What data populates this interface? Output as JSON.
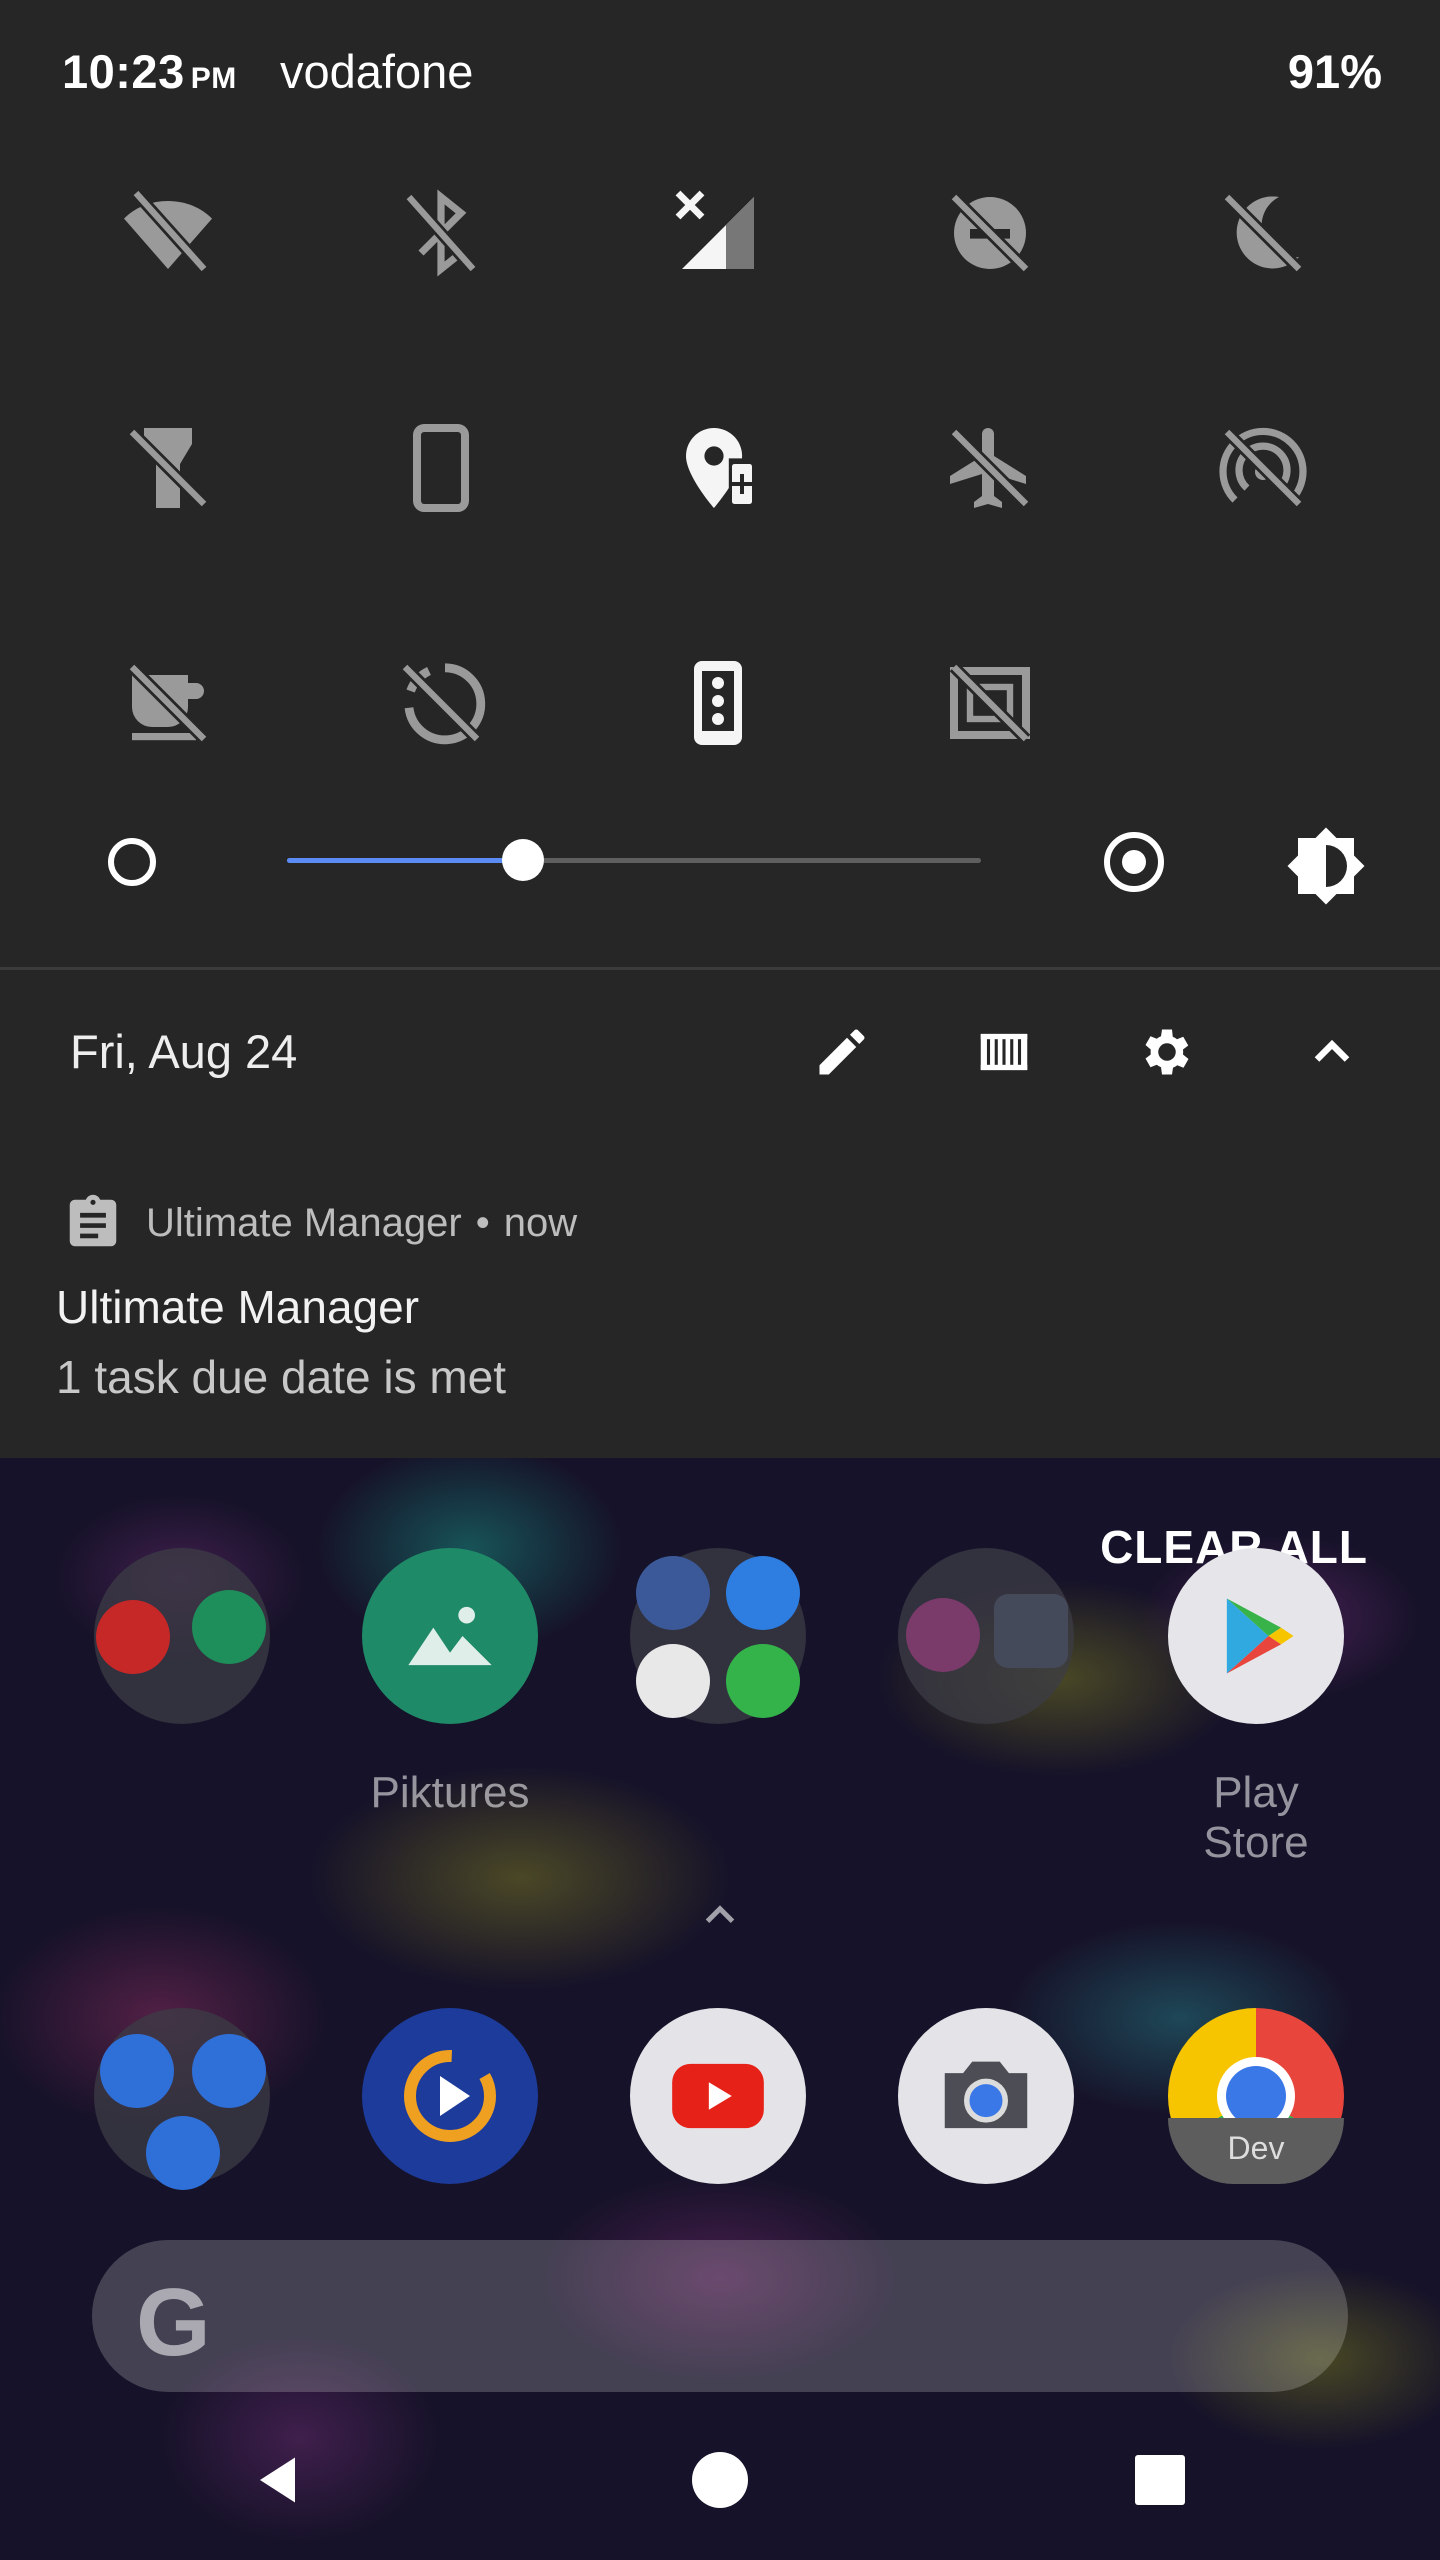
{
  "status_bar": {
    "time": "10:23",
    "ampm": "PM",
    "carrier": "vodafone",
    "battery": "91%"
  },
  "quick_settings": {
    "tiles": [
      {
        "icon": "wifi-off-icon"
      },
      {
        "icon": "bluetooth-off-icon"
      },
      {
        "icon": "cellular-no-data-icon"
      },
      {
        "icon": "do-not-disturb-off-icon"
      },
      {
        "icon": "night-light-off-icon"
      },
      {
        "icon": "flashlight-off-icon"
      },
      {
        "icon": "auto-rotate-portrait-icon"
      },
      {
        "icon": "location-battery-saver-icon"
      },
      {
        "icon": "airplane-mode-off-icon"
      },
      {
        "icon": "hotspot-off-icon"
      },
      {
        "icon": "caffeine-off-icon"
      },
      {
        "icon": "data-saver-off-icon"
      },
      {
        "icon": "phone-tile-icon"
      },
      {
        "icon": "screen-cast-off-icon"
      }
    ],
    "brightness_level": 0.34
  },
  "shade_footer": {
    "date": "Fri, Aug 24"
  },
  "notification": {
    "app": "Ultimate Manager",
    "separator": "•",
    "when": "now",
    "title": "Ultimate Manager",
    "text": "1 task due date is met"
  },
  "home": {
    "clear_all": "CLEAR ALL",
    "row1": [
      {
        "label": ""
      },
      {
        "label": "Piktures"
      },
      {
        "label": ""
      },
      {
        "label": ""
      },
      {
        "label": "Play Store"
      }
    ],
    "dock_badge": "Dev",
    "search_glyph": "G"
  },
  "colors": {
    "accent": "#5b8cf5",
    "panel": "#262626"
  }
}
